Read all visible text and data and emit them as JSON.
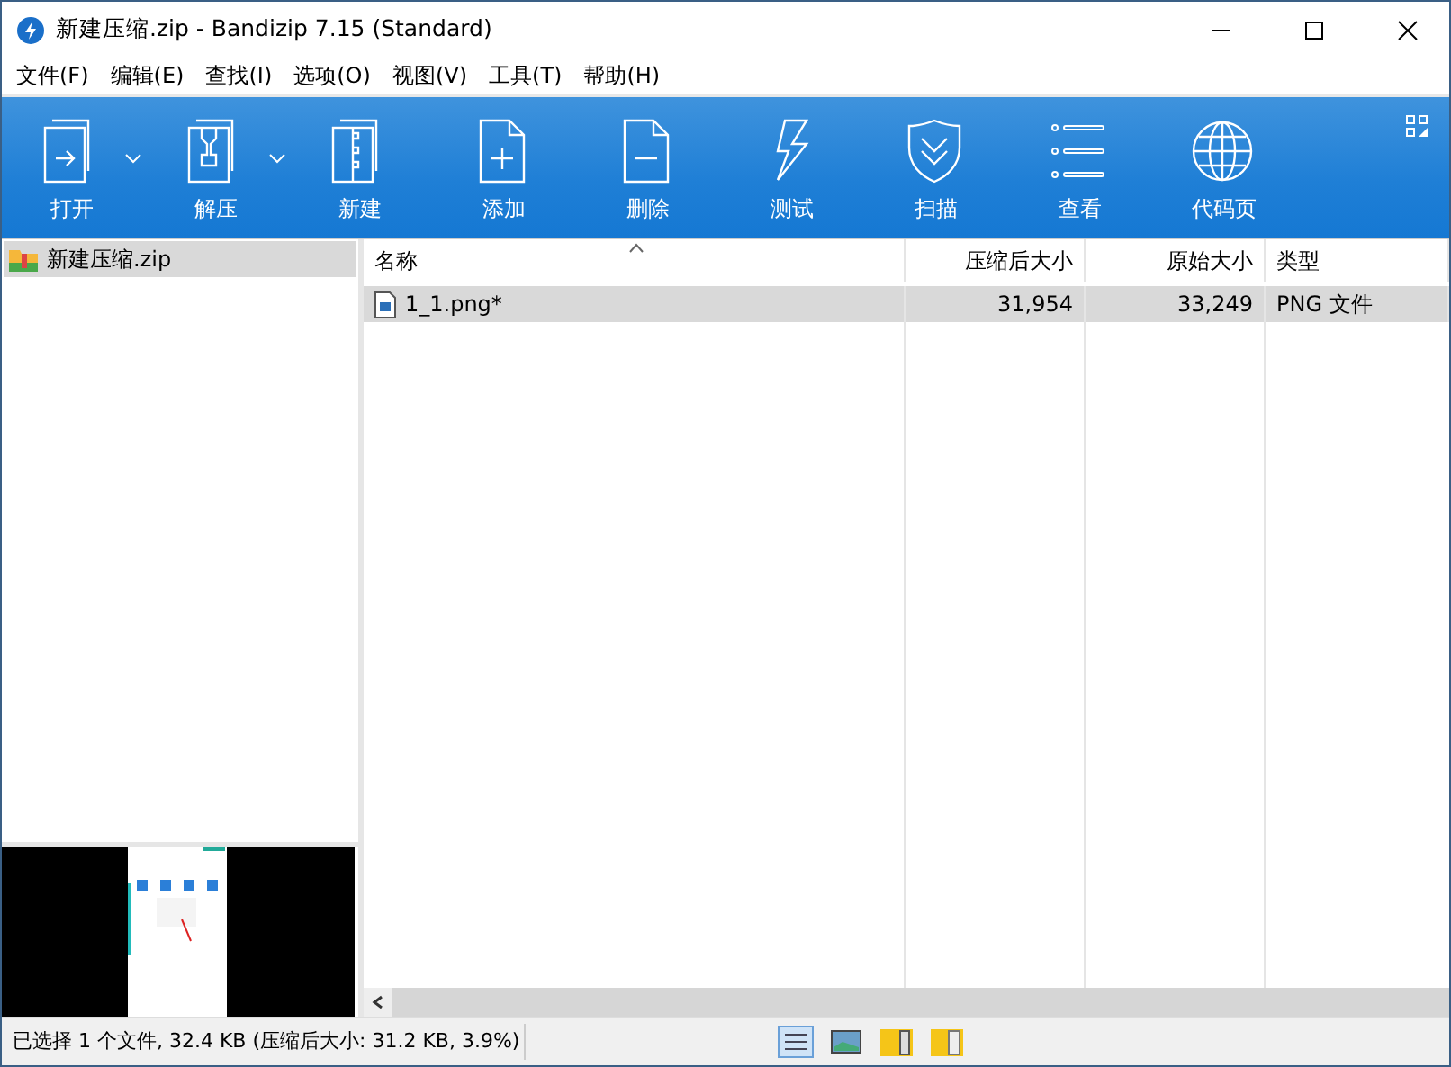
{
  "window": {
    "title": "新建压缩.zip - Bandizip 7.15 (Standard)"
  },
  "menu": [
    "文件(F)",
    "编辑(E)",
    "查找(I)",
    "选项(O)",
    "视图(V)",
    "工具(T)",
    "帮助(H)"
  ],
  "toolbar": [
    {
      "kind": "open",
      "label": "打开",
      "dropdown": true
    },
    {
      "kind": "extract",
      "label": "解压",
      "dropdown": true
    },
    {
      "kind": "new",
      "label": "新建",
      "dropdown": false
    },
    {
      "kind": "add",
      "label": "添加",
      "dropdown": false
    },
    {
      "kind": "delete",
      "label": "删除",
      "dropdown": false
    },
    {
      "kind": "test",
      "label": "测试",
      "dropdown": false
    },
    {
      "kind": "scan",
      "label": "扫描",
      "dropdown": false
    },
    {
      "kind": "view",
      "label": "查看",
      "dropdown": false
    },
    {
      "kind": "codepage",
      "label": "代码页",
      "dropdown": false
    }
  ],
  "tree": [
    {
      "label": "新建压缩.zip",
      "selected": true
    }
  ],
  "table": {
    "columns": [
      "名称",
      "压缩后大小",
      "原始大小",
      "类型"
    ],
    "rows": [
      {
        "cells": [
          "1_1.png*",
          "31,954",
          "33,249",
          "PNG 文件"
        ],
        "selected": true
      }
    ]
  },
  "status_bar": {
    "text": "已选择 1 个文件, 32.4 KB (压缩后大小: 31.2 KB, 3.9%)"
  }
}
